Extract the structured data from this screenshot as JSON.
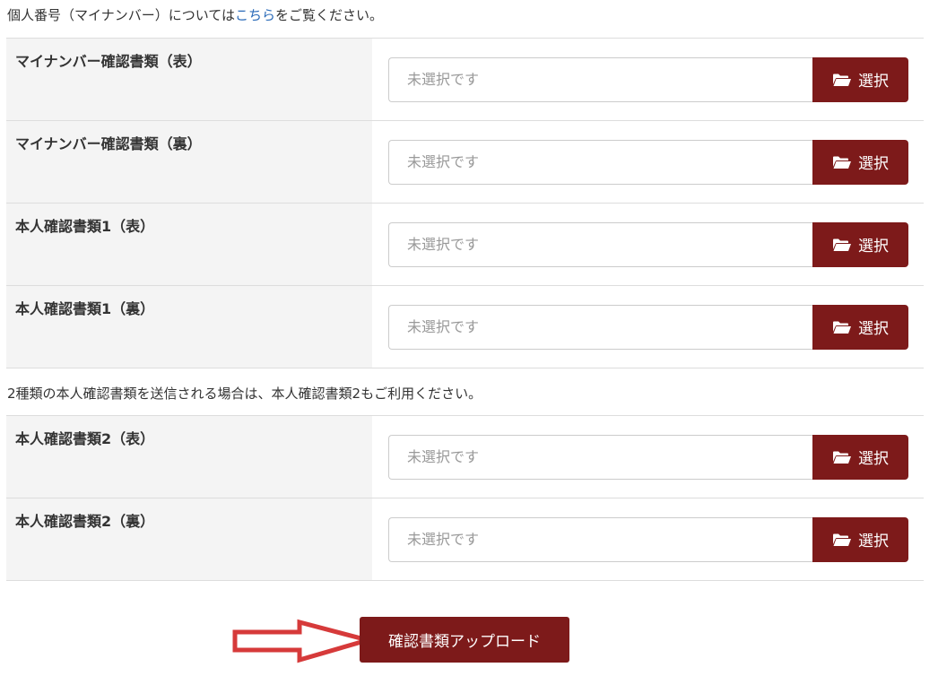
{
  "notice": {
    "prefix": "個人番号（マイナンバー）については",
    "link": "こちら",
    "suffix": "をご覧ください。"
  },
  "notice2": "2種類の本人確認書類を送信される場合は、本人確認書類2もご利用ください。",
  "group1": [
    {
      "label": "マイナンバー確認書類（表）",
      "placeholder": "未選択です",
      "button": "選択"
    },
    {
      "label": "マイナンバー確認書類（裏）",
      "placeholder": "未選択です",
      "button": "選択"
    },
    {
      "label": "本人確認書類1（表）",
      "placeholder": "未選択です",
      "button": "選択"
    },
    {
      "label": "本人確認書類1（裏）",
      "placeholder": "未選択です",
      "button": "選択"
    }
  ],
  "group2": [
    {
      "label": "本人確認書類2（表）",
      "placeholder": "未選択です",
      "button": "選択"
    },
    {
      "label": "本人確認書類2（裏）",
      "placeholder": "未選択です",
      "button": "選択"
    }
  ],
  "upload_button": "確認書類アップロード",
  "colors": {
    "button_bg": "#7d1a1a",
    "link": "#2a6ab8",
    "arrow": "#d63a3a"
  },
  "icons": {
    "folder": "folder-open-icon",
    "arrow": "right-arrow-icon"
  }
}
